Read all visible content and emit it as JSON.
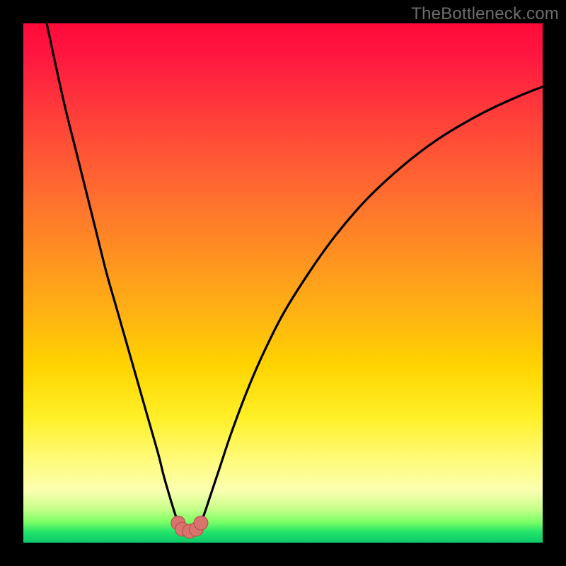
{
  "watermark": {
    "text": "TheBottleneck.com"
  },
  "colors": {
    "curve": "#000000",
    "marker_fill": "#d9736d",
    "marker_stroke": "#b44b45",
    "gradient_stops": [
      "#ff0a3a",
      "#ff6a30",
      "#ffd400",
      "#fbffb0",
      "#0cc96a"
    ]
  },
  "chart_data": {
    "type": "line",
    "title": "",
    "xlabel": "",
    "ylabel": "",
    "xlim": [
      0,
      100
    ],
    "ylim": [
      0,
      100
    ],
    "grid": false,
    "legend": false,
    "series": [
      {
        "name": "left-branch",
        "x": [
          4.5,
          6,
          8,
          10,
          12,
          14,
          16,
          18,
          20,
          22,
          24,
          26,
          27,
          28,
          29,
          29.8
        ],
        "values": [
          100,
          93,
          84,
          76,
          68,
          60,
          52,
          45,
          38,
          31,
          24,
          17,
          13,
          9.5,
          6.2,
          3.8
        ]
      },
      {
        "name": "right-branch",
        "x": [
          34.2,
          35,
          36,
          38,
          40,
          43,
          46,
          50,
          55,
          60,
          66,
          73,
          80,
          88,
          95,
          100
        ],
        "values": [
          3.8,
          6.0,
          9.0,
          15,
          21,
          29,
          36,
          44,
          52,
          59,
          66,
          72.5,
          77.8,
          82.5,
          85.8,
          87.8
        ]
      }
    ],
    "floor_connector": {
      "name": "valley-floor",
      "x": [
        29.8,
        30.6,
        32.0,
        33.3,
        34.2
      ],
      "values": [
        3.8,
        2.6,
        2.2,
        2.6,
        3.8
      ]
    },
    "markers": [
      {
        "name": "marker-left-end",
        "x": 29.8,
        "y": 3.8,
        "r": 1.35
      },
      {
        "name": "marker-left-mid",
        "x": 30.6,
        "y": 2.6,
        "r": 1.35
      },
      {
        "name": "marker-center",
        "x": 32.0,
        "y": 2.2,
        "r": 1.35
      },
      {
        "name": "marker-right-mid",
        "x": 33.3,
        "y": 2.6,
        "r": 1.35
      },
      {
        "name": "marker-right-end",
        "x": 34.2,
        "y": 3.8,
        "r": 1.35
      }
    ]
  }
}
